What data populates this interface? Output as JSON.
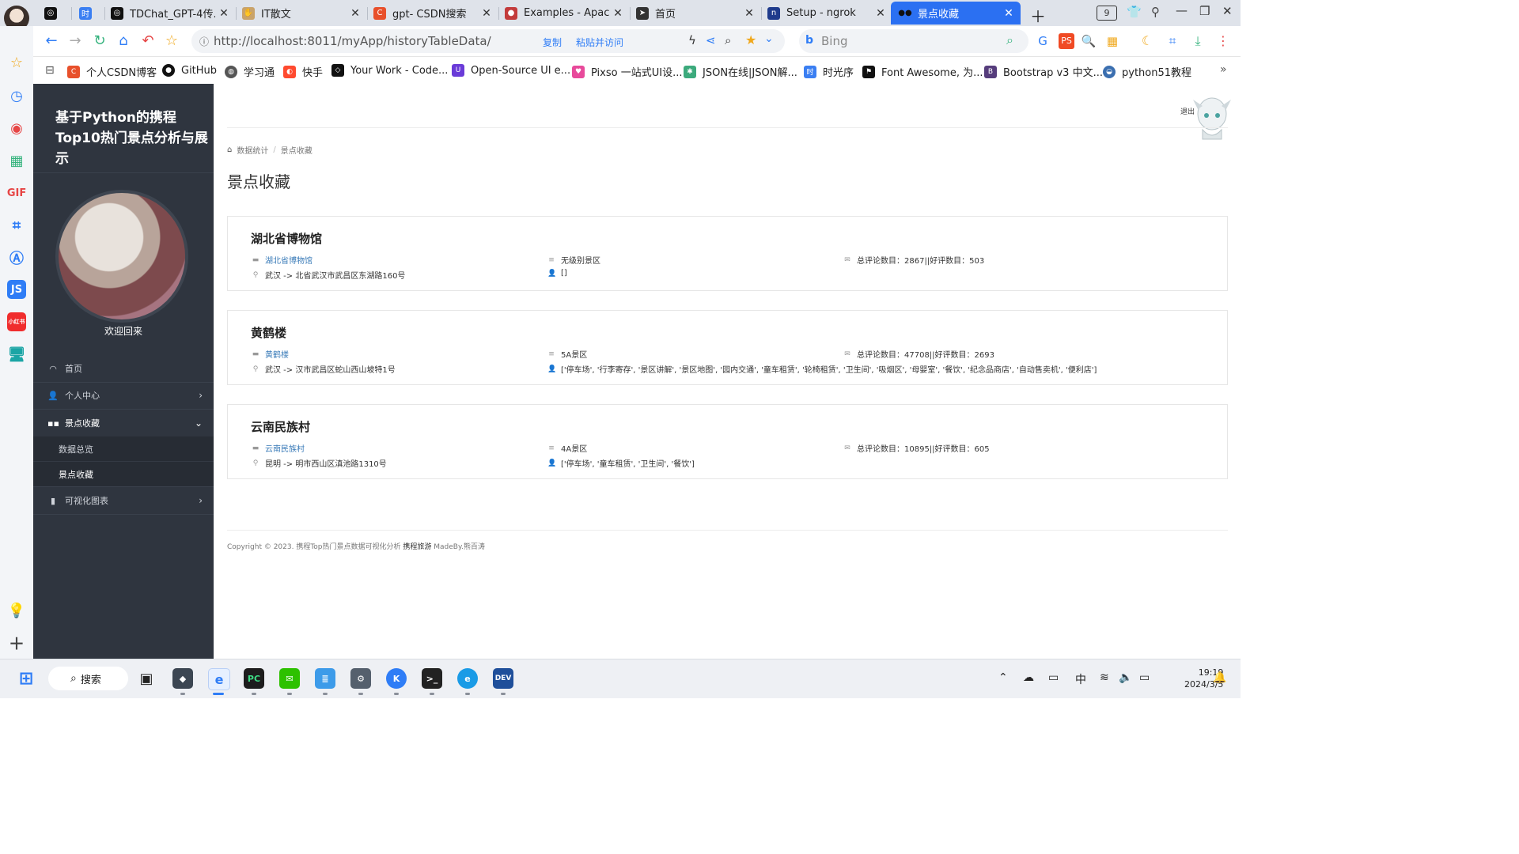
{
  "browser": {
    "tabs": [
      {
        "label": "",
        "icon": "chatgpt-icon",
        "color": "#111111",
        "active": false
      },
      {
        "label": "",
        "icon": "time-seq-icon",
        "color": "#3b7ff2",
        "active": false
      },
      {
        "label": "TDChat_GPT-4传...",
        "icon": "chatgpt-icon",
        "color": "#111111",
        "active": false
      },
      {
        "label": "IT散文",
        "icon": "it-icon",
        "color": "#c9a36b",
        "active": false
      },
      {
        "label": "gpt- CSDN搜索",
        "icon": "csdn-icon",
        "color": "#e8502b",
        "active": false
      },
      {
        "label": "Examples - Apac",
        "icon": "echarts-icon",
        "color": "#c33b3b",
        "active": false
      },
      {
        "label": "首页",
        "icon": "paper-plane-icon",
        "color": "#333333",
        "active": false
      },
      {
        "label": "Setup - ngrok",
        "icon": "ngrok-icon",
        "color": "#1f3b8c",
        "active": false
      },
      {
        "label": "景点收藏",
        "icon": "site-icon",
        "color": "#1a1a1a",
        "active": true
      }
    ],
    "tab_count": "9",
    "url": "http://localhost:8011/myApp/historyTableData/",
    "url_host": "localhost",
    "copy_label": "复制",
    "paste_visit_label": "粘贴并访问",
    "search_placeholder": "Bing"
  },
  "bookmarks": [
    {
      "label": "个人CSDN博客",
      "icon": "csdn-icon",
      "color": "#e8502b"
    },
    {
      "label": "GitHub",
      "icon": "github-icon",
      "color": "#111111"
    },
    {
      "label": "学习通",
      "icon": "globe-icon",
      "color": "#555555"
    },
    {
      "label": "快手",
      "icon": "kuaishou-icon",
      "color": "#ff4a2f"
    },
    {
      "label": "Your Work - Code...",
      "icon": "codepen-icon",
      "color": "#111111"
    },
    {
      "label": "Open-Source UI e...",
      "icon": "ui-icon",
      "color": "#6a3bd8"
    },
    {
      "label": "Pixso 一站式UI设...",
      "icon": "pixso-icon",
      "color": "#e84a9b"
    },
    {
      "label": "JSON在线|JSON解...",
      "icon": "json-icon",
      "color": "#3caa7c"
    },
    {
      "label": "时光序",
      "icon": "time-seq-icon",
      "color": "#3b7ff2"
    },
    {
      "label": "Font Awesome, 为...",
      "icon": "font-awesome-icon",
      "color": "#111111"
    },
    {
      "label": "Bootstrap v3 中文...",
      "icon": "bootstrap-icon",
      "color": "#563d7c"
    },
    {
      "label": "python51教程",
      "icon": "python-icon",
      "color": "#3b6fb0"
    }
  ],
  "sidebar": {
    "title": "基于Python的携程Top10热门景点分析与展示",
    "welcome": "欢迎回来",
    "menu": [
      {
        "label": "首页",
        "icon": "dashboard-icon"
      },
      {
        "label": "个人中心",
        "icon": "user-icon"
      },
      {
        "label": "景点收藏",
        "icon": "grid-icon"
      },
      {
        "label": "可视化图表",
        "icon": "bar-chart-icon"
      }
    ],
    "submenu": [
      {
        "label": "数据总览"
      },
      {
        "label": "景点收藏"
      }
    ]
  },
  "header": {
    "logout": "退出"
  },
  "breadcrumb": {
    "home": "数据统计",
    "current": "景点收藏"
  },
  "page": {
    "title": "景点收藏"
  },
  "cards": [
    {
      "title": "湖北省博物馆",
      "name_link": "湖北省博物馆",
      "location": "武汉 -> 北省武汉市武昌区东湖路160号",
      "level": "无级别景区",
      "facilities": "[]",
      "comments": "总评论数目：2867||好评数目：503"
    },
    {
      "title": "黄鹤楼",
      "name_link": "黄鹤楼",
      "location": "武汉 -> 汉市武昌区蛇山西山坡特1号",
      "level": "5A景区",
      "facilities": "['停车场', '行李寄存', '景区讲解', '景区地图', '园内交通', '童车租赁', '轮椅租赁', '卫生间', '吸烟区', '母婴室', '餐饮', '纪念品商店', '自动售卖机', '便利店']",
      "comments": "总评论数目：47708||好评数目：2693"
    },
    {
      "title": "云南民族村",
      "name_link": "云南民族村",
      "location": "昆明 -> 明市西山区滇池路1310号",
      "level": "4A景区",
      "facilities": "['停车场', '童车租赁', '卫生间', '餐饮']",
      "comments": "总评论数目：10895||好评数目：605"
    }
  ],
  "footer": {
    "prefix": "Copyright © 2023. 携程Top热门景点数据可视化分析 ",
    "brand": "携程旅游",
    "suffix": " MadeBy.熊百涛"
  },
  "taskbar": {
    "search_label": "搜索",
    "time": "19:19",
    "date": "2024/3/5",
    "ime": "中"
  }
}
